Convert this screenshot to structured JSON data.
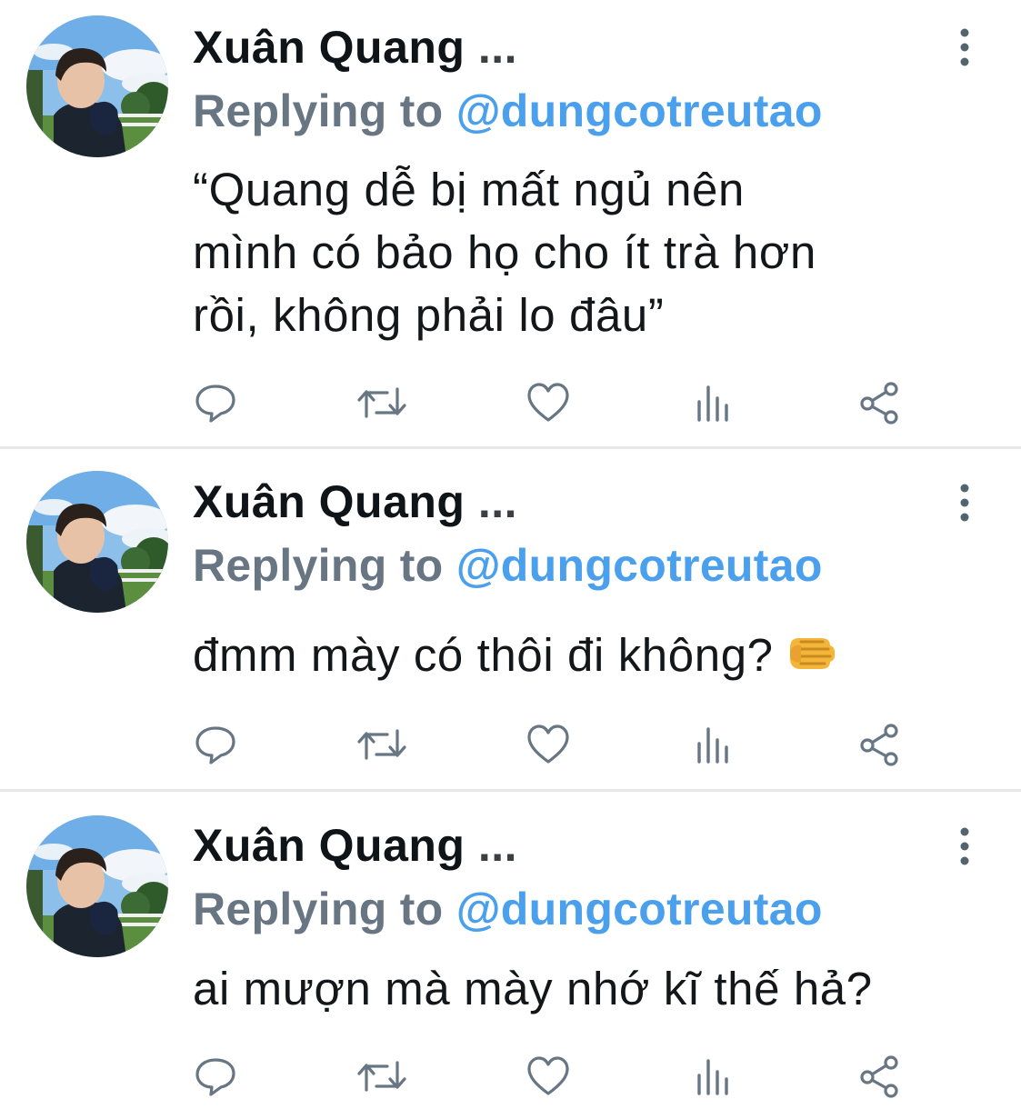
{
  "tweets": [
    {
      "name": "Xuân Quang",
      "ellipsis": "...",
      "replying_label": "Replying to",
      "handle": "@dungcotreutao",
      "text_lines": [
        "“Quang dễ bị mất ngủ nên",
        "mình có bảo họ cho ít trà hơn",
        "rồi, không phải lo đâu”"
      ]
    },
    {
      "name": "Xuân Quang",
      "ellipsis": "...",
      "replying_label": "Replying to",
      "handle": "@dungcotreutao",
      "text": "đmm mày có thôi đi không?",
      "emoji": "fist-pointing-icon"
    },
    {
      "name": "Xuân Quang",
      "ellipsis": "...",
      "replying_label": "Replying to",
      "handle": "@dungcotreutao",
      "text": "ai mượn mà mày nhớ kĩ thế hả?"
    }
  ],
  "action_icons": [
    "reply-icon",
    "retweet-icon",
    "like-icon",
    "analytics-icon",
    "share-icon"
  ],
  "colors": {
    "name": "#0f1419",
    "replying_label": "#687684",
    "handle": "#4aa0ec",
    "text": "#14171a",
    "icon": "#687684",
    "divider": "#e6e9ec"
  }
}
